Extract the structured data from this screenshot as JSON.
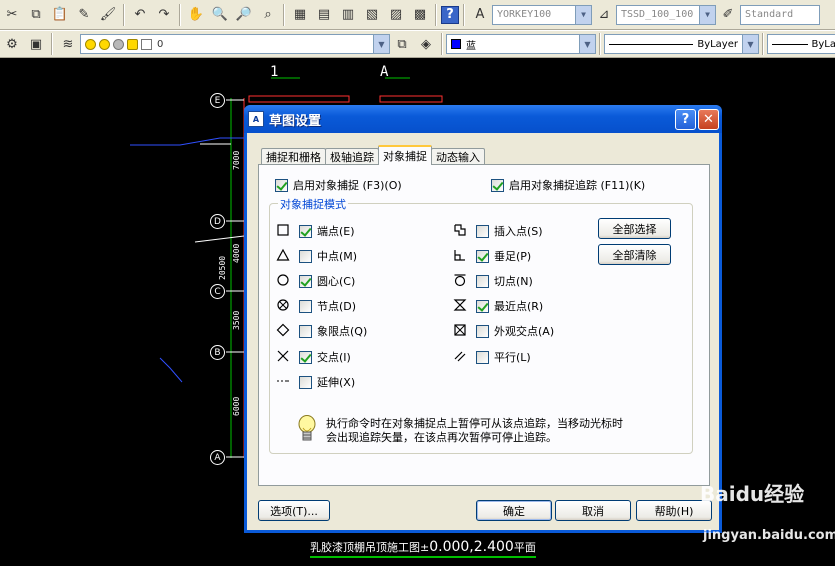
{
  "toolbar1": {
    "style_combo": "YORKEY100",
    "dim_style_combo": "TSSD_100_100",
    "table_style_combo": "Standard"
  },
  "toolbar2": {
    "layer_combo": "0",
    "color_combo": "蓝",
    "linetype_combo": "ByLayer",
    "lineweight_combo": "ByLa"
  },
  "drawing": {
    "axis_top_labels": [
      "1",
      "A"
    ],
    "axis_bubbles": [
      "E",
      "D",
      "C",
      "B",
      "A"
    ],
    "dims": [
      "7000",
      "4000",
      "20500",
      "3500",
      "6000"
    ],
    "bottom_title_prefix": "乳胶漆顶棚吊顶施工图±",
    "bottom_title_values": "0.000,2.400",
    "bottom_title_suffix": "平面"
  },
  "dialog": {
    "title": "草图设置",
    "title_help": "?",
    "title_close": "✕",
    "tabs": [
      "捕捉和栅格",
      "极轴追踪",
      "对象捕捉",
      "动态输入"
    ],
    "active_tab": 2,
    "enable_osnap": {
      "label": "启用对象捕捉 (F3)(O)",
      "checked": true
    },
    "enable_track": {
      "label": "启用对象捕捉追踪 (F11)(K)",
      "checked": true
    },
    "group_title": "对象捕捉模式",
    "modes_left": [
      {
        "label": "端点(E)",
        "checked": true,
        "icon": "endpoint-icon"
      },
      {
        "label": "中点(M)",
        "checked": false,
        "icon": "midpoint-icon"
      },
      {
        "label": "圆心(C)",
        "checked": true,
        "icon": "center-icon"
      },
      {
        "label": "节点(D)",
        "checked": false,
        "icon": "node-icon"
      },
      {
        "label": "象限点(Q)",
        "checked": false,
        "icon": "quadrant-icon"
      },
      {
        "label": "交点(I)",
        "checked": true,
        "icon": "intersection-icon"
      },
      {
        "label": "延伸(X)",
        "checked": false,
        "icon": "extension-icon"
      }
    ],
    "modes_right": [
      {
        "label": "插入点(S)",
        "checked": false,
        "icon": "insertion-icon"
      },
      {
        "label": "垂足(P)",
        "checked": true,
        "icon": "perpendicular-icon"
      },
      {
        "label": "切点(N)",
        "checked": false,
        "icon": "tangent-icon"
      },
      {
        "label": "最近点(R)",
        "checked": true,
        "icon": "nearest-icon"
      },
      {
        "label": "外观交点(A)",
        "checked": false,
        "icon": "apparent-intersection-icon"
      },
      {
        "label": "平行(L)",
        "checked": false,
        "icon": "parallel-icon"
      }
    ],
    "select_all": "全部选择",
    "clear_all": "全部清除",
    "info_line1": "执行命令时在对象捕捉点上暂停可从该点追踪，当移动光标时",
    "info_line2": "会出现追踪矢量，在该点再次暂停可停止追踪。",
    "options_button": "选项(T)...",
    "ok_button": "确定",
    "cancel_button": "取消",
    "help_button": "帮助(H)"
  },
  "watermark": {
    "brand": "Baidu经验",
    "url": "jingyan.baidu.com"
  }
}
